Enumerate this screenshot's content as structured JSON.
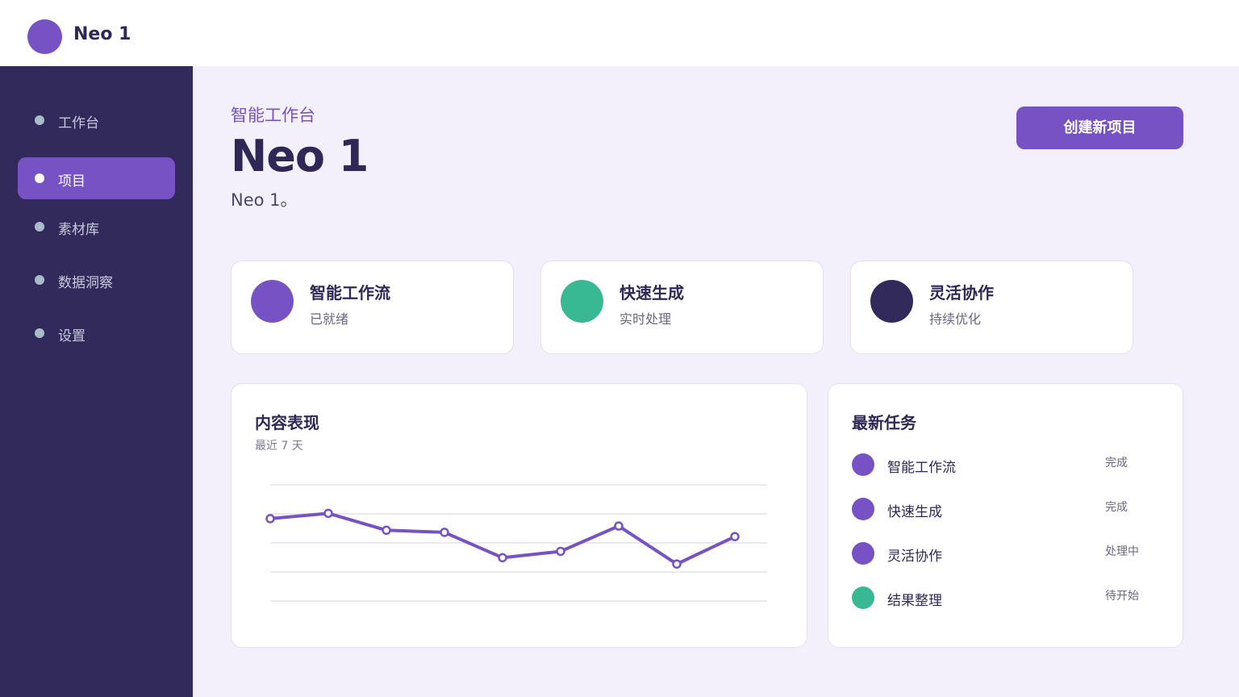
{
  "header": {
    "app_title": "Neo 1",
    "logo_color": "#7652c4"
  },
  "sidebar": {
    "items": [
      {
        "label": "工作台",
        "active": false
      },
      {
        "label": "项目",
        "active": true
      },
      {
        "label": "素材库",
        "active": false
      },
      {
        "label": "数据洞察",
        "active": false
      },
      {
        "label": "设置",
        "active": false
      }
    ]
  },
  "main": {
    "subtitle": "智能工作台",
    "title": "Neo 1",
    "description": "Neo 1。",
    "create_button": "创建新项目"
  },
  "features": [
    {
      "title": "智能工作流",
      "subtitle": "已就绪",
      "color": "#7652c4"
    },
    {
      "title": "快速生成",
      "subtitle": "实时处理",
      "color": "#38b994"
    },
    {
      "title": "灵活协作",
      "subtitle": "持续优化",
      "color": "#332a5c"
    }
  ],
  "chart_card": {
    "title": "内容表现",
    "subtitle": "最近 7 天"
  },
  "chart_data": {
    "type": "line",
    "series": [
      {
        "values": [
          78,
          83,
          67,
          65,
          41,
          47,
          71,
          35,
          61
        ]
      }
    ],
    "ylim": [
      0,
      110
    ],
    "grid": true,
    "color": "#7652c4"
  },
  "tasks_card": {
    "title": "最新任务",
    "items": [
      {
        "name": "智能工作流",
        "status": "完成",
        "color": "#7652c4"
      },
      {
        "name": "快速生成",
        "status": "完成",
        "color": "#7652c4"
      },
      {
        "name": "灵活协作",
        "status": "处理中",
        "color": "#7652c4"
      },
      {
        "name": "结果整理",
        "status": "待开始",
        "color": "#38b994"
      }
    ]
  }
}
